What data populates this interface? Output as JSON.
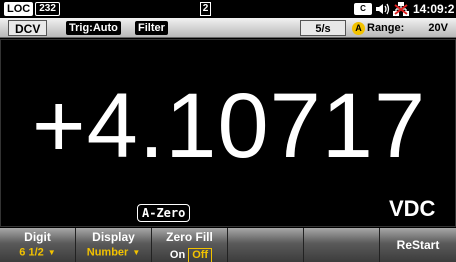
{
  "status": {
    "remote_label": "LOC",
    "port_label": "232",
    "page_indicator": "2",
    "sd_label": "C",
    "clock": "14:09:2"
  },
  "mode_bar": {
    "function": "DCV",
    "trigger": "Trig:Auto",
    "filter": "Filter",
    "rate": "5/s",
    "auto_icon": "A",
    "range_label": "Range:",
    "range_value": "20V"
  },
  "display": {
    "reading": "+4.10717",
    "azero": "A-Zero",
    "unit": "VDC"
  },
  "softkeys": {
    "digit": {
      "label": "Digit",
      "value": "6 1/2"
    },
    "display": {
      "label": "Display",
      "value": "Number"
    },
    "zero_fill": {
      "label": "Zero Fill",
      "option_on": "On",
      "option_off": "Off",
      "selected": "Off"
    },
    "restart": {
      "label": "ReStart"
    }
  },
  "colors": {
    "accent": "#f2c200",
    "background": "#000000",
    "mute_icon": "#e02020"
  }
}
